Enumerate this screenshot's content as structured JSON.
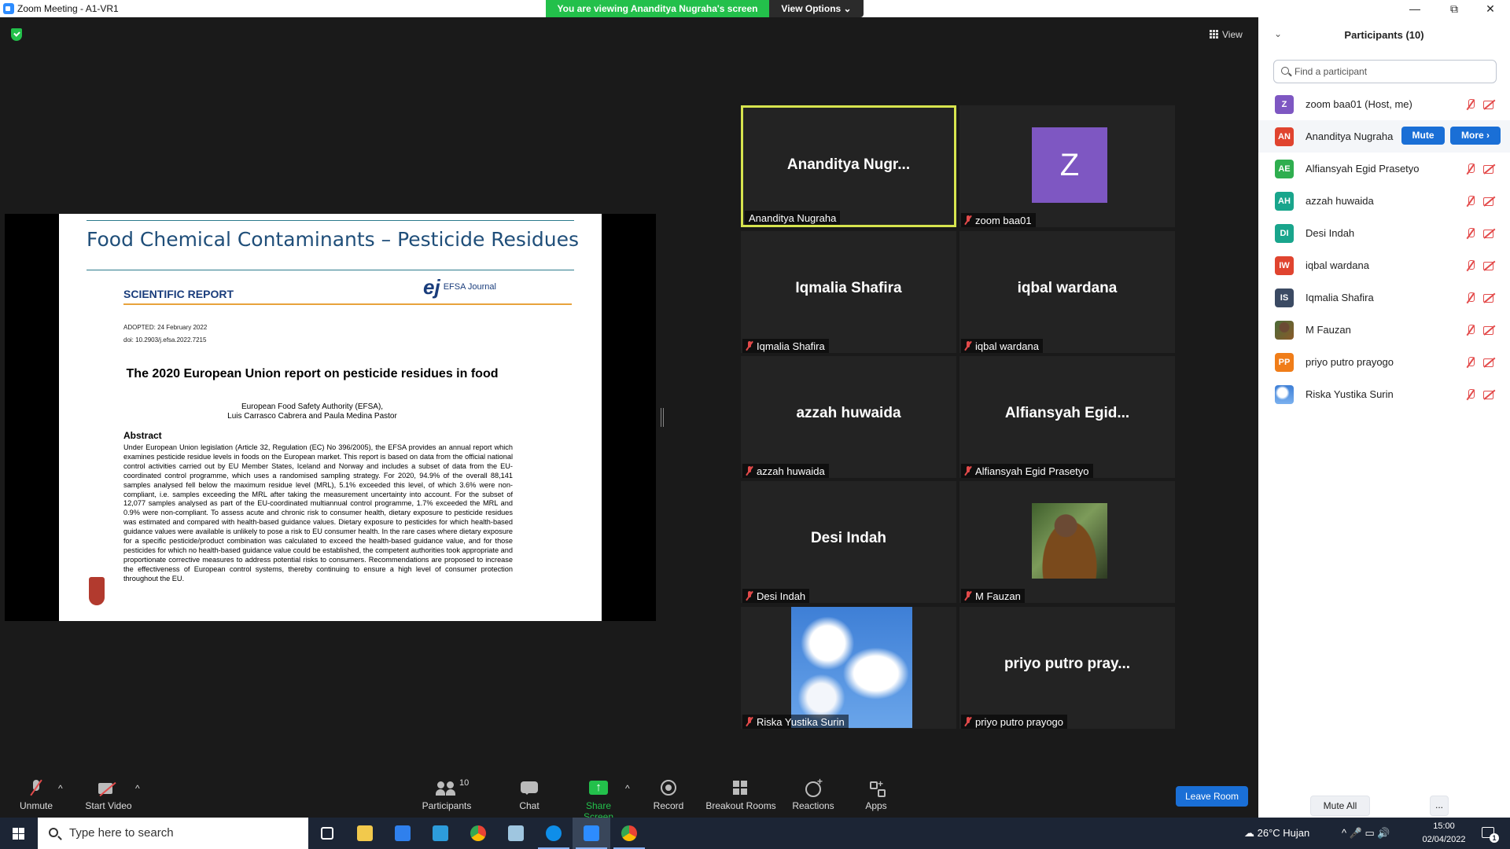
{
  "window": {
    "title": "Zoom Meeting - A1-VR1",
    "viewing_banner": "You are viewing Ananditya Nugraha's screen",
    "view_options": "View Options ⌄",
    "minimize": "—",
    "maximize": "⧉",
    "close": "✕"
  },
  "meeting": {
    "view_label": "View"
  },
  "shared_doc": {
    "slide_title": "Food Chemical Contaminants – Pesticide Residues",
    "report_label": "SCIENTIFIC REPORT",
    "journal": "EFSA Journal",
    "journal_mark": "ej",
    "adopted": "ADOPTED: 24 February 2022",
    "doi": "doi: 10.2903/j.efsa.2022.7215",
    "paper_title": "The 2020 European Union report on pesticide residues in food",
    "authors_line1": "European Food Safety Authority (EFSA),",
    "authors_line2": "Luis Carrasco Cabrera and Paula Medina Pastor",
    "abstract_heading": "Abstract",
    "abstract_text": "Under European Union legislation (Article 32, Regulation (EC) No 396/2005), the EFSA provides an annual report which examines pesticide residue levels in foods on the European market. This report is based on data from the official national control activities carried out by EU Member States, Iceland and Norway and includes a subset of data from the EU-coordinated control programme, which uses a randomised sampling strategy. For 2020, 94.9% of the overall 88,141 samples analysed fell below the maximum residue level (MRL), 5.1% exceeded this level, of which 3.6% were non-compliant, i.e. samples exceeding the MRL after taking the measurement uncertainty into account. For the subset of 12,077 samples analysed as part of the EU-coordinated multiannual control programme, 1.7% exceeded the MRL and 0.9% were non-compliant. To assess acute and chronic risk to consumer health, dietary exposure to pesticide residues was estimated and compared with health-based guidance values. Dietary exposure to pesticides for which health-based guidance values were available is unlikely to pose a risk to EU consumer health. In the rare cases where dietary exposure for a specific pesticide/product combination was calculated to exceed the health-based guidance value, and for those pesticides for which no health-based guidance value could be established, the competent authorities took appropriate and proportionate corrective measures to address potential risks to consumers. Recommendations are proposed to increase the effectiveness of European control systems, thereby continuing to ensure a high level of consumer protection throughout the EU."
  },
  "tiles": [
    {
      "display": "Ananditya  Nugr...",
      "label": "Ananditya Nugraha",
      "muted": false,
      "active": true
    },
    {
      "display": "Z",
      "label": "zoom baa01",
      "muted": true,
      "avatar": true
    },
    {
      "display": "Iqmalia Shafira",
      "label": "Iqmalia Shafira",
      "muted": true
    },
    {
      "display": "iqbal wardana",
      "label": "iqbal wardana",
      "muted": true
    },
    {
      "display": "azzah huwaida",
      "label": "azzah huwaida",
      "muted": true
    },
    {
      "display": "Alfiansyah  Egid...",
      "label": "Alfiansyah Egid Prasetyo",
      "muted": true
    },
    {
      "display": "Desi Indah",
      "label": "Desi Indah",
      "muted": true
    },
    {
      "display": "",
      "label": "M Fauzan",
      "muted": true,
      "photo": "person"
    },
    {
      "display": "",
      "label": "Riska Yustika Surin",
      "muted": true,
      "photo": "sky"
    },
    {
      "display": "priyo putro pray...",
      "label": "priyo putro prayogo",
      "muted": true
    }
  ],
  "toolbar": {
    "unmute": "Unmute",
    "start_video": "Start Video",
    "participants": "Participants",
    "participants_count": "10",
    "chat": "Chat",
    "share_screen": "Share Screen",
    "record": "Record",
    "breakout_rooms": "Breakout Rooms",
    "reactions": "Reactions",
    "apps": "Apps",
    "leave_room": "Leave Room",
    "caret": "^"
  },
  "panel": {
    "title": "Participants (10)",
    "collapse": "⌄",
    "search_placeholder": "Find a participant",
    "mute": "Mute",
    "more": "More ›",
    "mute_all": "Mute All",
    "more_dots": "...",
    "participants": [
      {
        "initials": "Z",
        "name": "zoom baa01 (Host, me)",
        "color": "#7e57c2"
      },
      {
        "initials": "AN",
        "name": "Ananditya Nugraha",
        "color": "#e0442f"
      },
      {
        "initials": "AE",
        "name": "Alfiansyah Egid Prasetyo",
        "color": "#2fae4f"
      },
      {
        "initials": "AH",
        "name": "azzah huwaida",
        "color": "#19a58c"
      },
      {
        "initials": "DI",
        "name": "Desi Indah",
        "color": "#19a58c"
      },
      {
        "initials": "IW",
        "name": "iqbal wardana",
        "color": "#e0442f"
      },
      {
        "initials": "IS",
        "name": "Iqmalia Shafira",
        "color": "#3b4a63"
      },
      {
        "initials": "",
        "name": "M Fauzan",
        "color": "#5a6b3a"
      },
      {
        "initials": "PP",
        "name": "priyo putro prayogo",
        "color": "#f07d19"
      },
      {
        "initials": "",
        "name": "Riska Yustika Surin",
        "color": "#3e7fd6"
      }
    ]
  },
  "taskbar": {
    "search_placeholder": "Type here to search",
    "weather": "26°C  Hujan",
    "time": "15:00",
    "date": "02/04/2022",
    "notif_count": "1",
    "tray_icons": "^  🎤  ▭  🔊"
  }
}
